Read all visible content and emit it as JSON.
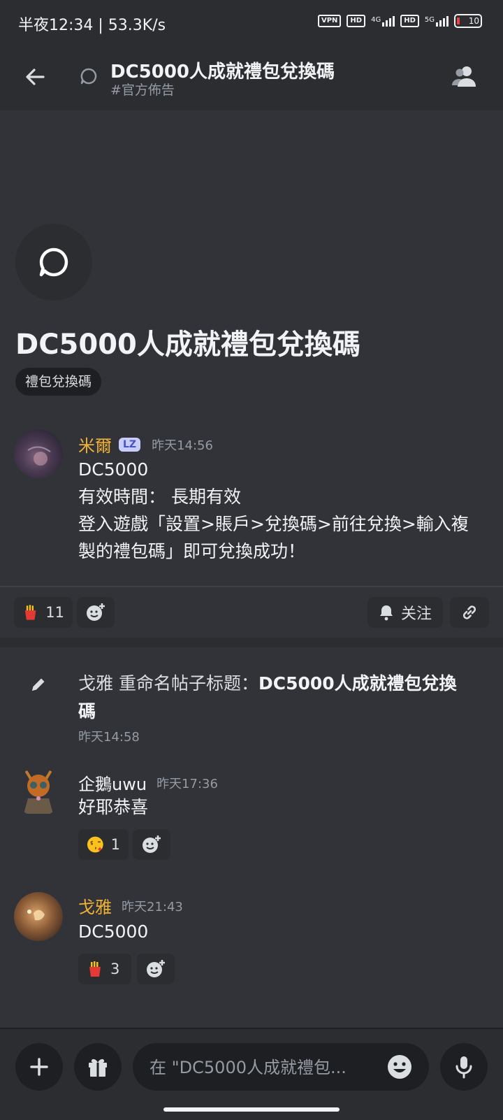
{
  "status_bar": {
    "time": "半夜12:34 | 53.3K/s",
    "vpn": "VPN",
    "hd1": "HD",
    "net1": "4G",
    "hd2": "HD",
    "net2": "5G",
    "battery": "10"
  },
  "header": {
    "title": "DC5000人成就禮包兌換碼",
    "channel": "#官方佈告"
  },
  "intro": {
    "title": "DC5000人成就禮包兌換碼",
    "tag": "禮包兌換碼"
  },
  "post": {
    "author": "米爾",
    "badge": "LZ",
    "time": "昨天14:56",
    "lines": [
      "DC5000",
      "有效時間：  長期有效",
      "登入遊戲「設置>賬戶>兌換碼>前往兌換>輸入複",
      "製的禮包碼」即可兌換成功！"
    ],
    "reaction_count": "11",
    "follow_label": "关注"
  },
  "system": {
    "actor": "戈雅",
    "action": " 重命名帖子标题：",
    "new_title": "DC5000人成就禮包兌換",
    "new_title_cont": "碼",
    "time": "昨天14:58"
  },
  "messages": [
    {
      "author": "企鵝uwu",
      "time": "昨天17:36",
      "text": "好耶恭喜",
      "reaction_count": "1"
    },
    {
      "author": "戈雅",
      "time": "昨天21:43",
      "text": "DC5000",
      "reaction_count": "3"
    }
  ],
  "composer": {
    "placeholder": "在 \"DC5000人成就禮包..."
  },
  "colors": {
    "background": "#313338",
    "bar": "#2b2d31",
    "username_highlight": "#f0b232",
    "muted": "#949ba4"
  }
}
